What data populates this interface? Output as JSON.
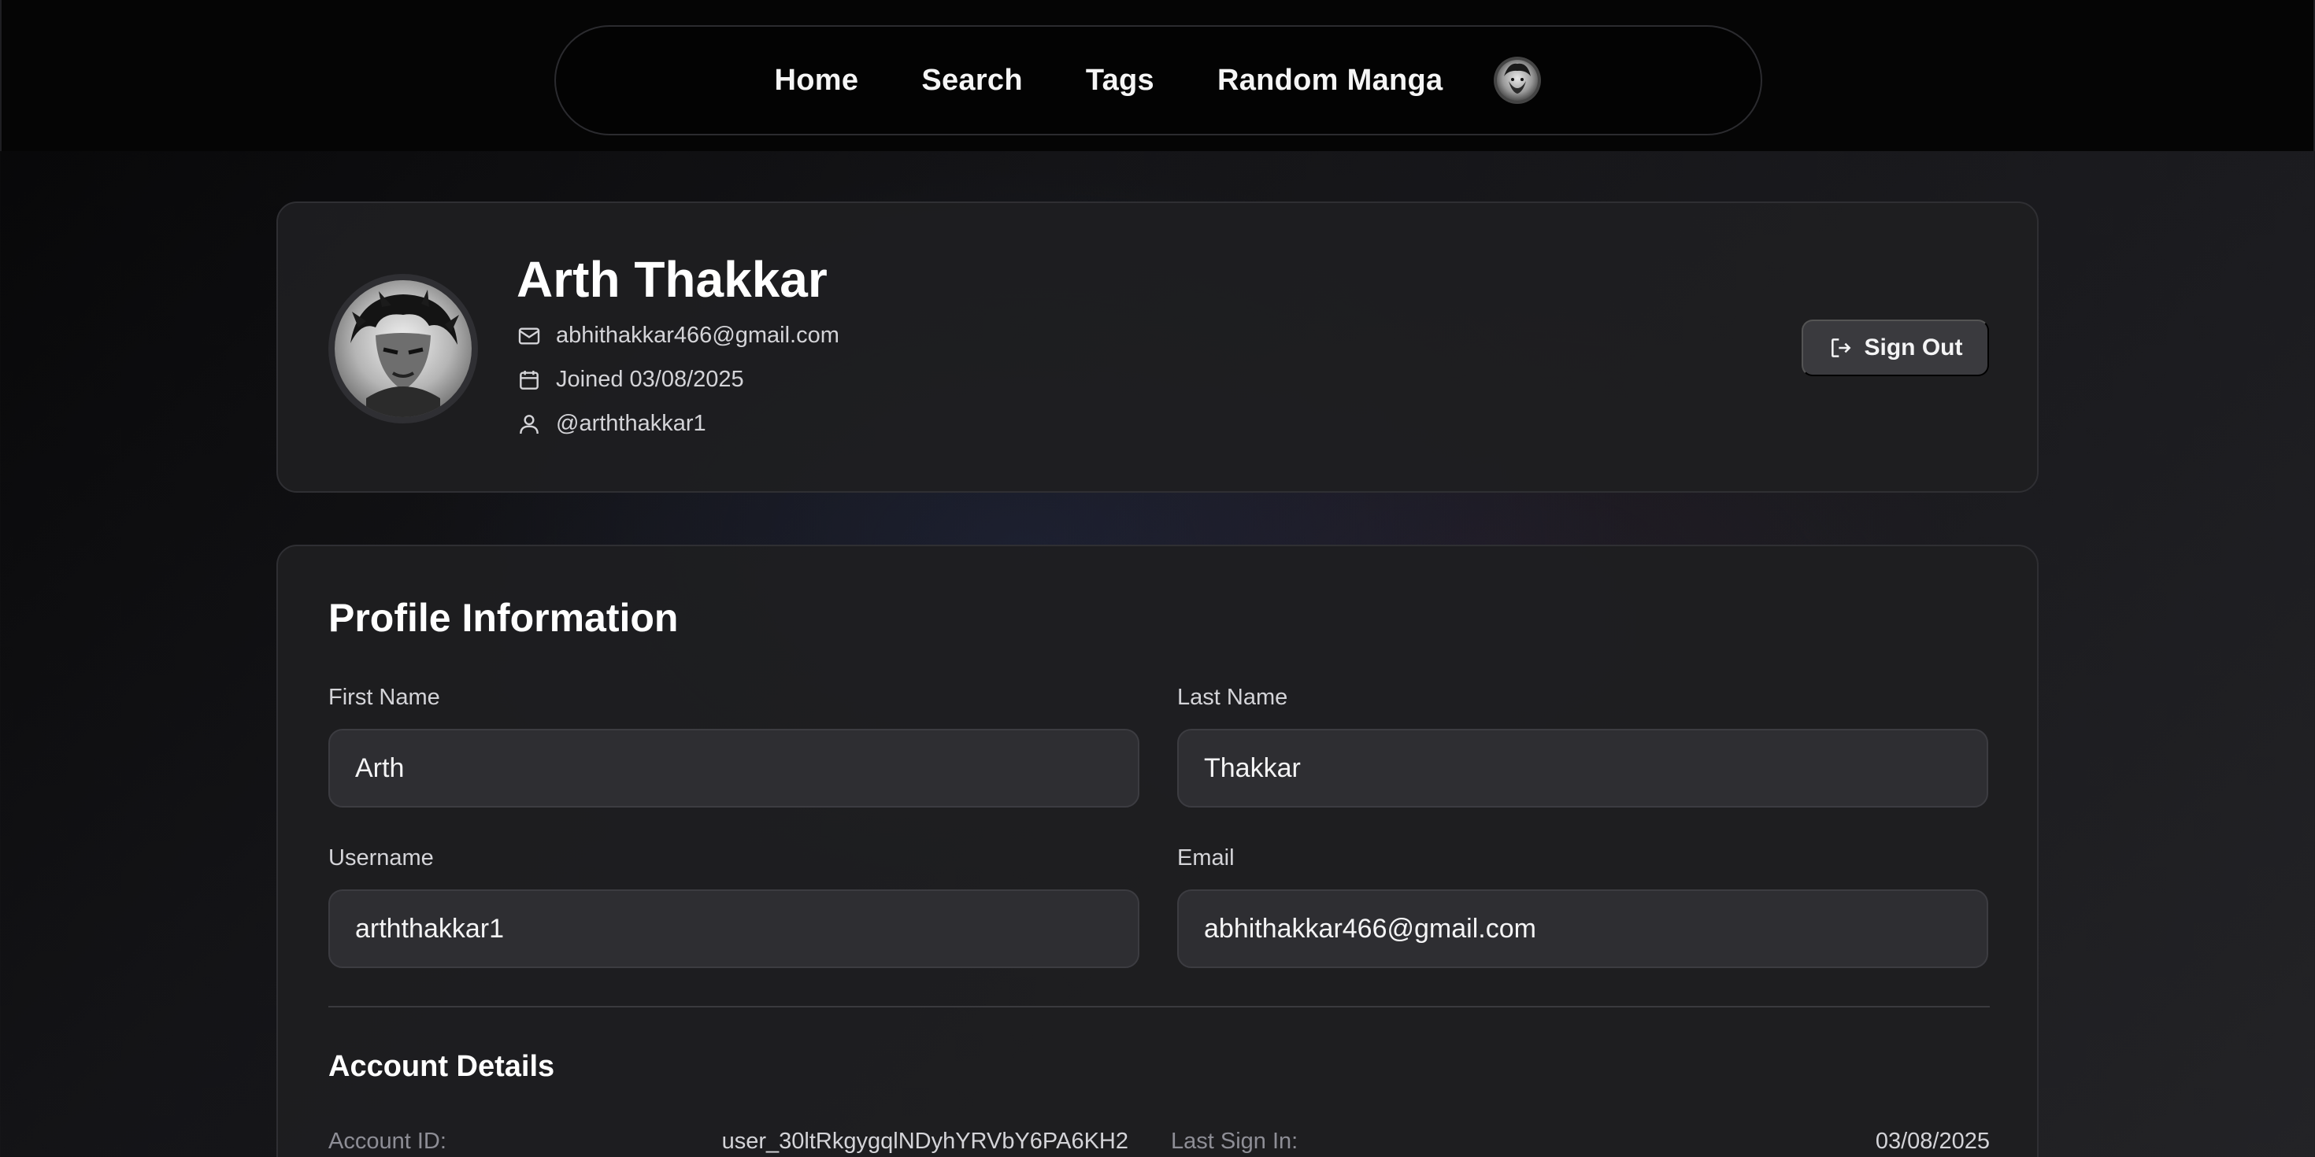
{
  "nav": {
    "links": [
      "Home",
      "Search",
      "Tags",
      "Random Manga"
    ]
  },
  "profile": {
    "name": "Arth Thakkar",
    "email": "abhithakkar466@gmail.com",
    "joined": "Joined 03/08/2025",
    "username": "@arththakkar1",
    "signout_label": "Sign Out"
  },
  "profile_info": {
    "title": "Profile Information",
    "fields": {
      "first_name": {
        "label": "First Name",
        "value": "Arth"
      },
      "last_name": {
        "label": "Last Name",
        "value": "Thakkar"
      },
      "username": {
        "label": "Username",
        "value": "arththakkar1"
      },
      "email": {
        "label": "Email",
        "value": "abhithakkar466@gmail.com"
      }
    }
  },
  "account_details": {
    "title": "Account Details",
    "account_id_label": "Account ID:",
    "account_id": "user_30ltRkgygqlNDyhYRVbY6PA6KH2",
    "last_sign_in_label": "Last Sign In:",
    "last_sign_in": "03/08/2025"
  },
  "colors": {
    "background": "#141417",
    "card": "#1e1e21",
    "input": "#2e2e32",
    "button": "#3a3a3e"
  },
  "icons": [
    "avatar-image",
    "mail-icon",
    "calendar-icon",
    "user-icon",
    "sign-out-icon"
  ]
}
